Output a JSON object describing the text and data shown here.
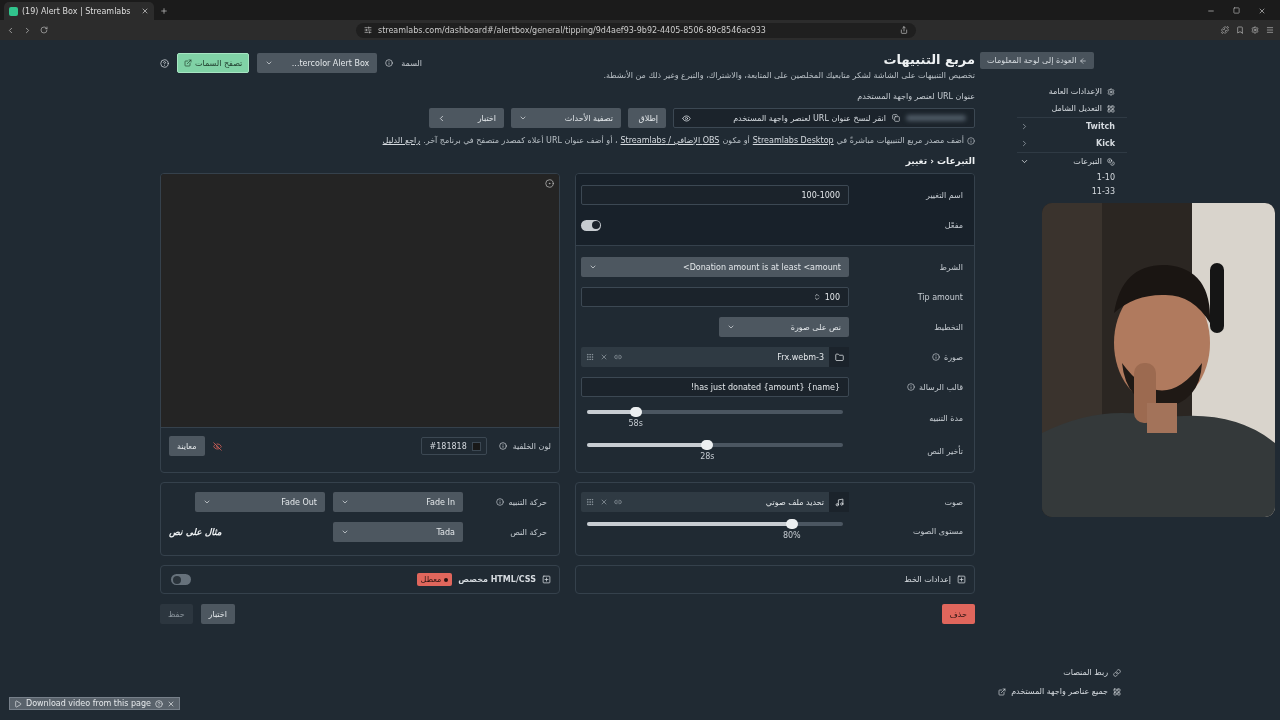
{
  "browser": {
    "tabs": [
      {
        "title": "(19) Alert Box | Streamlabs",
        "selected": true
      }
    ],
    "url": "streamlabs.com/dashboard#/alertbox/general/tipping/9d4aef93-9b92-4405-8506-89c8546ac933"
  },
  "header": {
    "title": "مربع التنبيهات",
    "description": "تخصيص التنبيهات على الشاشة لشكر متابعيك المخلصين على المتابعة، والاشتراك، والتبرع وغير ذلك من الأنشطة.",
    "theme_label": "السمة",
    "theme_value": "...tercolor Alert Box",
    "browse_button": "تصفح السمات"
  },
  "widget_url": {
    "label": "عنوان URL لعنصر واجهة المستخدم",
    "copy_hint": "انقر لنسخ عنوان URL لعنصر واجهة المستخدم",
    "launch_button": "إطلاق",
    "filter_select": "تصفية الأحداث",
    "test_button": "اختبار"
  },
  "note": [
    {
      "kind": "text",
      "text": "أضف مصدر مربع التنبيهات مباشرةً في"
    },
    {
      "kind": "link",
      "text": "Streamlabs Desktop"
    },
    {
      "kind": "text",
      "text": "أو مكون"
    },
    {
      "kind": "link",
      "text": "OBS الإضافي / Streamlabs"
    },
    {
      "kind": "text",
      "text": "، أو أضف عنوان URL أعلاه كمصدر متصفح في برنامج آخر."
    },
    {
      "kind": "link",
      "text": "راجع الدليل"
    }
  ],
  "breadcrumb": "التبرعات ‹ تغيير",
  "settings": {
    "top_rows": [
      {
        "kind": "text",
        "label": "اسم التغيير",
        "value": "100-1000"
      },
      {
        "kind": "toggle",
        "label": "مفعّل",
        "on": true
      }
    ],
    "rows": [
      {
        "kind": "select",
        "label": "الشرط",
        "value": "<Donation amount is at least <amount"
      },
      {
        "kind": "number",
        "label": "Tip amount",
        "value": "100"
      },
      {
        "kind": "select-short",
        "label": "التخطيط",
        "value": "نص على صورة"
      },
      {
        "kind": "file",
        "label": "صورة",
        "value": "Frx.webm-3",
        "info": true
      },
      {
        "kind": "text",
        "label": "قالب الرسالة",
        "value": "!has just donated {amount} {name}",
        "info": true
      },
      {
        "kind": "slider",
        "label": "مدة التنبيه",
        "level": 0.19,
        "reading": "58s"
      },
      {
        "kind": "slider",
        "label": "تأخير النص",
        "level": 0.47,
        "reading": "28s"
      }
    ]
  },
  "preview": {
    "background_label": "لون الخلفية",
    "background_value": "#181818",
    "preview_button": "معاينة"
  },
  "sound": {
    "label": "صوت",
    "file": "تحديد ملف صوتي",
    "volume_label": "مستوى الصوت",
    "level": 0.8,
    "reading": "80%"
  },
  "animation": {
    "alert_label": "حركة التنبيه",
    "alert_in": "Fade In",
    "alert_out": "Fade Out",
    "text_label": "حركة النص",
    "text_animation": "Tada",
    "sample": "مثال على نص"
  },
  "font_settings": {
    "label": "إعدادات الخط",
    "expanded": false
  },
  "custom_code": {
    "label": "HTML/CSS مخصص",
    "status": "معطل",
    "on": false,
    "expanded": false
  },
  "actions": {
    "delete_button": "حذف",
    "test_button": "اختبار",
    "save_button": "حفظ",
    "save_disabled": true
  },
  "sidebar": {
    "back_button": "العودة إلى لوحة المعلومات",
    "items": [
      {
        "kind": "gear",
        "label": "الإعدادات العامة"
      },
      {
        "kind": "grid",
        "label": "التعديل الشامل"
      },
      {
        "kind": "platform",
        "label": "Twitch",
        "expanded": false
      },
      {
        "kind": "platform",
        "label": "Kick",
        "expanded": false
      },
      {
        "kind": "category",
        "label": "التبرعات",
        "expanded": true,
        "children": [
          {
            "label": "1-10"
          },
          {
            "label": "11-33"
          }
        ]
      }
    ],
    "footer": [
      {
        "kind": "link",
        "label": "ربط المنصات"
      },
      {
        "kind": "apps",
        "label": "جميع عناصر واجهة المستخدم"
      }
    ]
  },
  "download_bar": {
    "label": "Download video from this page"
  }
}
